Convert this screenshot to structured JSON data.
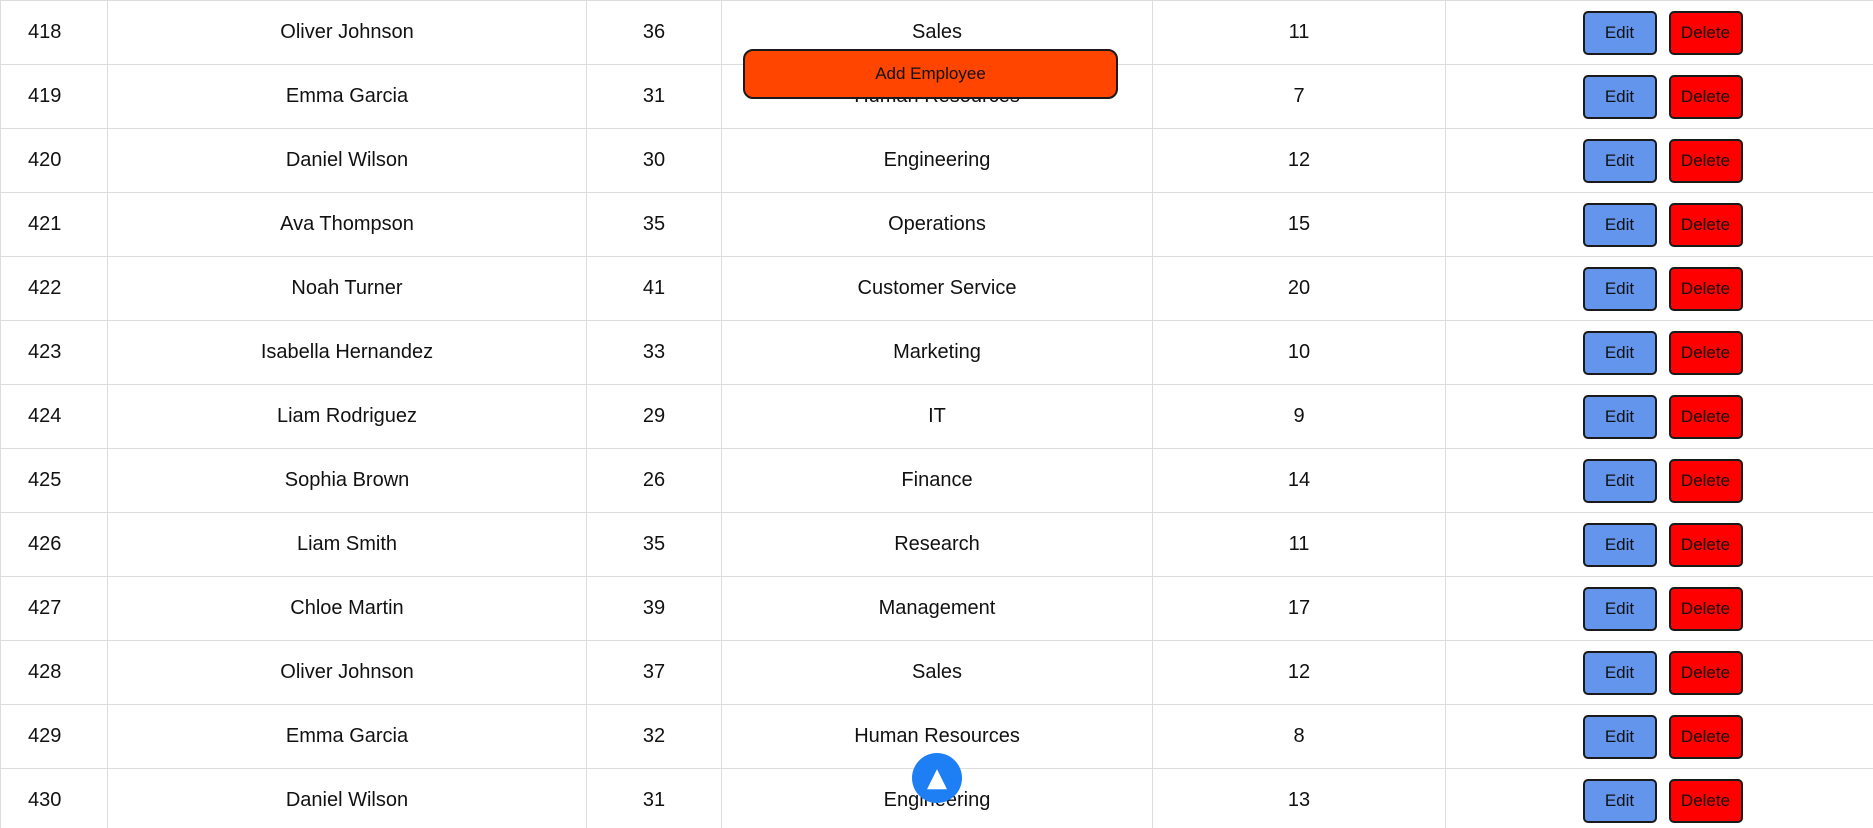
{
  "buttons": {
    "add_employee": "Add Employee",
    "edit": "Edit",
    "delete": "Delete",
    "scroll_top_icon": "▲"
  },
  "colors": {
    "add_employee_bg": "#ff4500",
    "edit_bg": "#6495ed",
    "delete_bg": "#ff0000",
    "scroll_top_bg": "#1e7ff5"
  },
  "rows": [
    {
      "id": "418",
      "name": "Oliver Johnson",
      "age": "36",
      "department": "Sales",
      "experience": "11"
    },
    {
      "id": "419",
      "name": "Emma Garcia",
      "age": "31",
      "department": "Human Resources",
      "experience": "7"
    },
    {
      "id": "420",
      "name": "Daniel Wilson",
      "age": "30",
      "department": "Engineering",
      "experience": "12"
    },
    {
      "id": "421",
      "name": "Ava Thompson",
      "age": "35",
      "department": "Operations",
      "experience": "15"
    },
    {
      "id": "422",
      "name": "Noah Turner",
      "age": "41",
      "department": "Customer Service",
      "experience": "20"
    },
    {
      "id": "423",
      "name": "Isabella Hernandez",
      "age": "33",
      "department": "Marketing",
      "experience": "10"
    },
    {
      "id": "424",
      "name": "Liam Rodriguez",
      "age": "29",
      "department": "IT",
      "experience": "9"
    },
    {
      "id": "425",
      "name": "Sophia Brown",
      "age": "26",
      "department": "Finance",
      "experience": "14"
    },
    {
      "id": "426",
      "name": "Liam Smith",
      "age": "35",
      "department": "Research",
      "experience": "11"
    },
    {
      "id": "427",
      "name": "Chloe Martin",
      "age": "39",
      "department": "Management",
      "experience": "17"
    },
    {
      "id": "428",
      "name": "Oliver Johnson",
      "age": "37",
      "department": "Sales",
      "experience": "12"
    },
    {
      "id": "429",
      "name": "Emma Garcia",
      "age": "32",
      "department": "Human Resources",
      "experience": "8"
    },
    {
      "id": "430",
      "name": "Daniel Wilson",
      "age": "31",
      "department": "Engineering",
      "experience": "13"
    }
  ]
}
